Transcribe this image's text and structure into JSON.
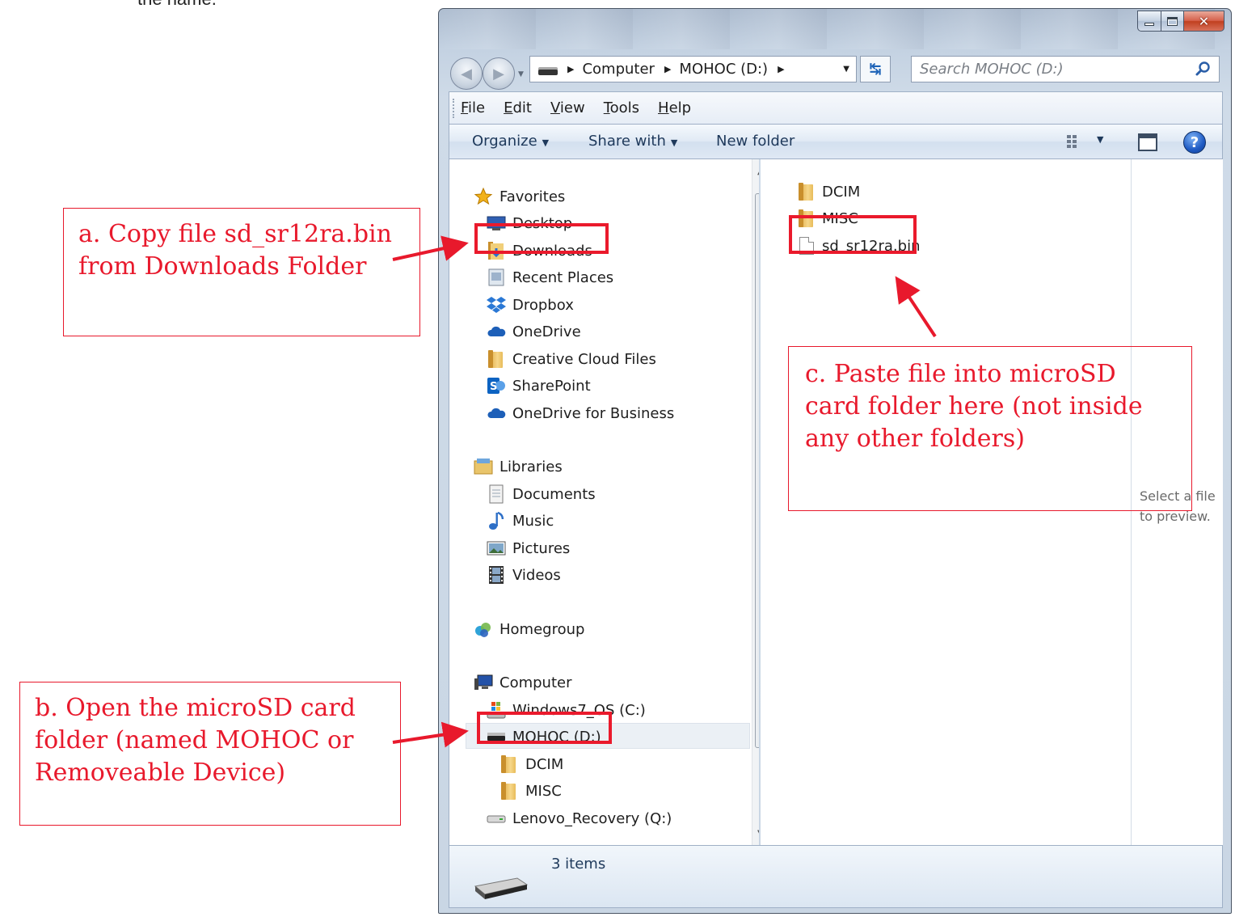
{
  "top_fragment": "the name.",
  "window": {
    "address": {
      "crumbs": [
        "Computer",
        "MOHOC (D:)"
      ]
    },
    "search_placeholder": "Search MOHOC (D:)",
    "menu": [
      {
        "key": "F",
        "rest": "ile"
      },
      {
        "key": "E",
        "rest": "dit"
      },
      {
        "key": "V",
        "rest": "iew"
      },
      {
        "key": "T",
        "rest": "ools"
      },
      {
        "key": "H",
        "rest": "elp"
      }
    ],
    "commands": {
      "organize": "Organize",
      "share_with": "Share with",
      "new_folder": "New folder"
    },
    "nav_pane": {
      "favorites": "Favorites",
      "desktop": "Desktop",
      "downloads": "Downloads",
      "recent_places": "Recent Places",
      "dropbox": "Dropbox",
      "onedrive": "OneDrive",
      "creative_cloud": "Creative Cloud Files",
      "sharepoint": "SharePoint",
      "onedrive_business": "OneDrive for Business",
      "libraries": "Libraries",
      "documents": "Documents",
      "music": "Music",
      "pictures": "Pictures",
      "videos": "Videos",
      "homegroup": "Homegroup",
      "computer": "Computer",
      "windows_os": "Windows7_OS (C:)",
      "mohoc": "MOHOC (D:)",
      "dcim": "DCIM",
      "misc": "MISC",
      "lenovo": "Lenovo_Recovery (Q:)"
    },
    "files": [
      "DCIM",
      "MISC",
      "sd_sr12ra.bin"
    ],
    "preview_text": "Select a file to preview.",
    "status": "3 items"
  },
  "annotations": {
    "a_line1": "a.  Copy file sd_sr12ra.bin",
    "a_line2": "from Downloads Folder",
    "b_line1": "b.  Open the microSD card",
    "b_line2": "folder (named MOHOC or",
    "b_line3": "Removeable Device)",
    "c_line1": "c.    Paste file into microSD",
    "c_line2": "card folder here (not inside",
    "c_line3": "any other folders)"
  },
  "colors": {
    "annotation_red": "#e8192c",
    "window_frame": "#c4d2e2"
  }
}
